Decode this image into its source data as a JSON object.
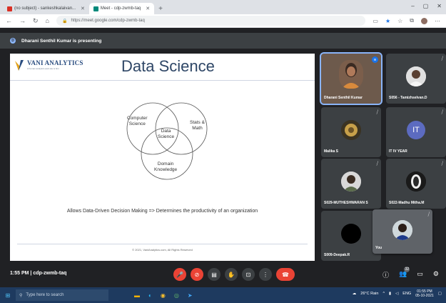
{
  "browser": {
    "tabs": [
      {
        "label": "(no subject) - sankeshkalaivan...",
        "active": false
      },
      {
        "label": "Meet - cdp-zwmb-taq",
        "active": true
      }
    ],
    "new_tab": "+",
    "window_controls": [
      "–",
      "▢",
      "✕"
    ],
    "url": "https://meet.google.com/cdp-zwmb-taq"
  },
  "meet": {
    "presenting_banner": "Dharani Senthil Kumar is presenting",
    "slide": {
      "logo_text": "VANI ANALYTICS",
      "logo_subtext": "A human analytics web site &amp; firm",
      "title": "Data Science",
      "venn": {
        "computer_science": "Computer\nScience",
        "stats_math": "Stats &\nMath",
        "data_science": "Data\nScience",
        "domain_knowledge": "Domain\nKnowledge"
      },
      "caption": "Allows Data-Driven Decision Making  => Determines the productivity of an organization",
      "footer": "© 2021, VaniAnalytics.com, All Rights Reserved"
    },
    "participants": [
      {
        "name": "Dharani Senthil Kumar",
        "speaking": true
      },
      {
        "name": "S056 - Tamizhselvan.D",
        "speaking": false
      },
      {
        "name": "Malika S",
        "speaking": false
      },
      {
        "name": "IT IV YEAR",
        "initials": "IT",
        "speaking": false
      },
      {
        "name": "S029-MUTHESHWARAN S",
        "speaking": false
      },
      {
        "name": "S022-Madhu Mitha.M",
        "speaking": false
      },
      {
        "name": "S009-Deepak.R",
        "speaking": false
      }
    ],
    "self_tile": {
      "name": "You"
    },
    "time": "1:55 PM",
    "separator": "|",
    "meeting_code": "cdp-zwmb-taq",
    "people_count": "32",
    "colors": {
      "accent": "#1a73e8",
      "end_call": "#ea4335",
      "bg": "#202124"
    }
  },
  "taskbar": {
    "search_placeholder": "Type here to search",
    "weather": "26°C  Rain",
    "lang": "ENG",
    "clock_time": "01:55 PM",
    "clock_date": "05-10-2021"
  }
}
